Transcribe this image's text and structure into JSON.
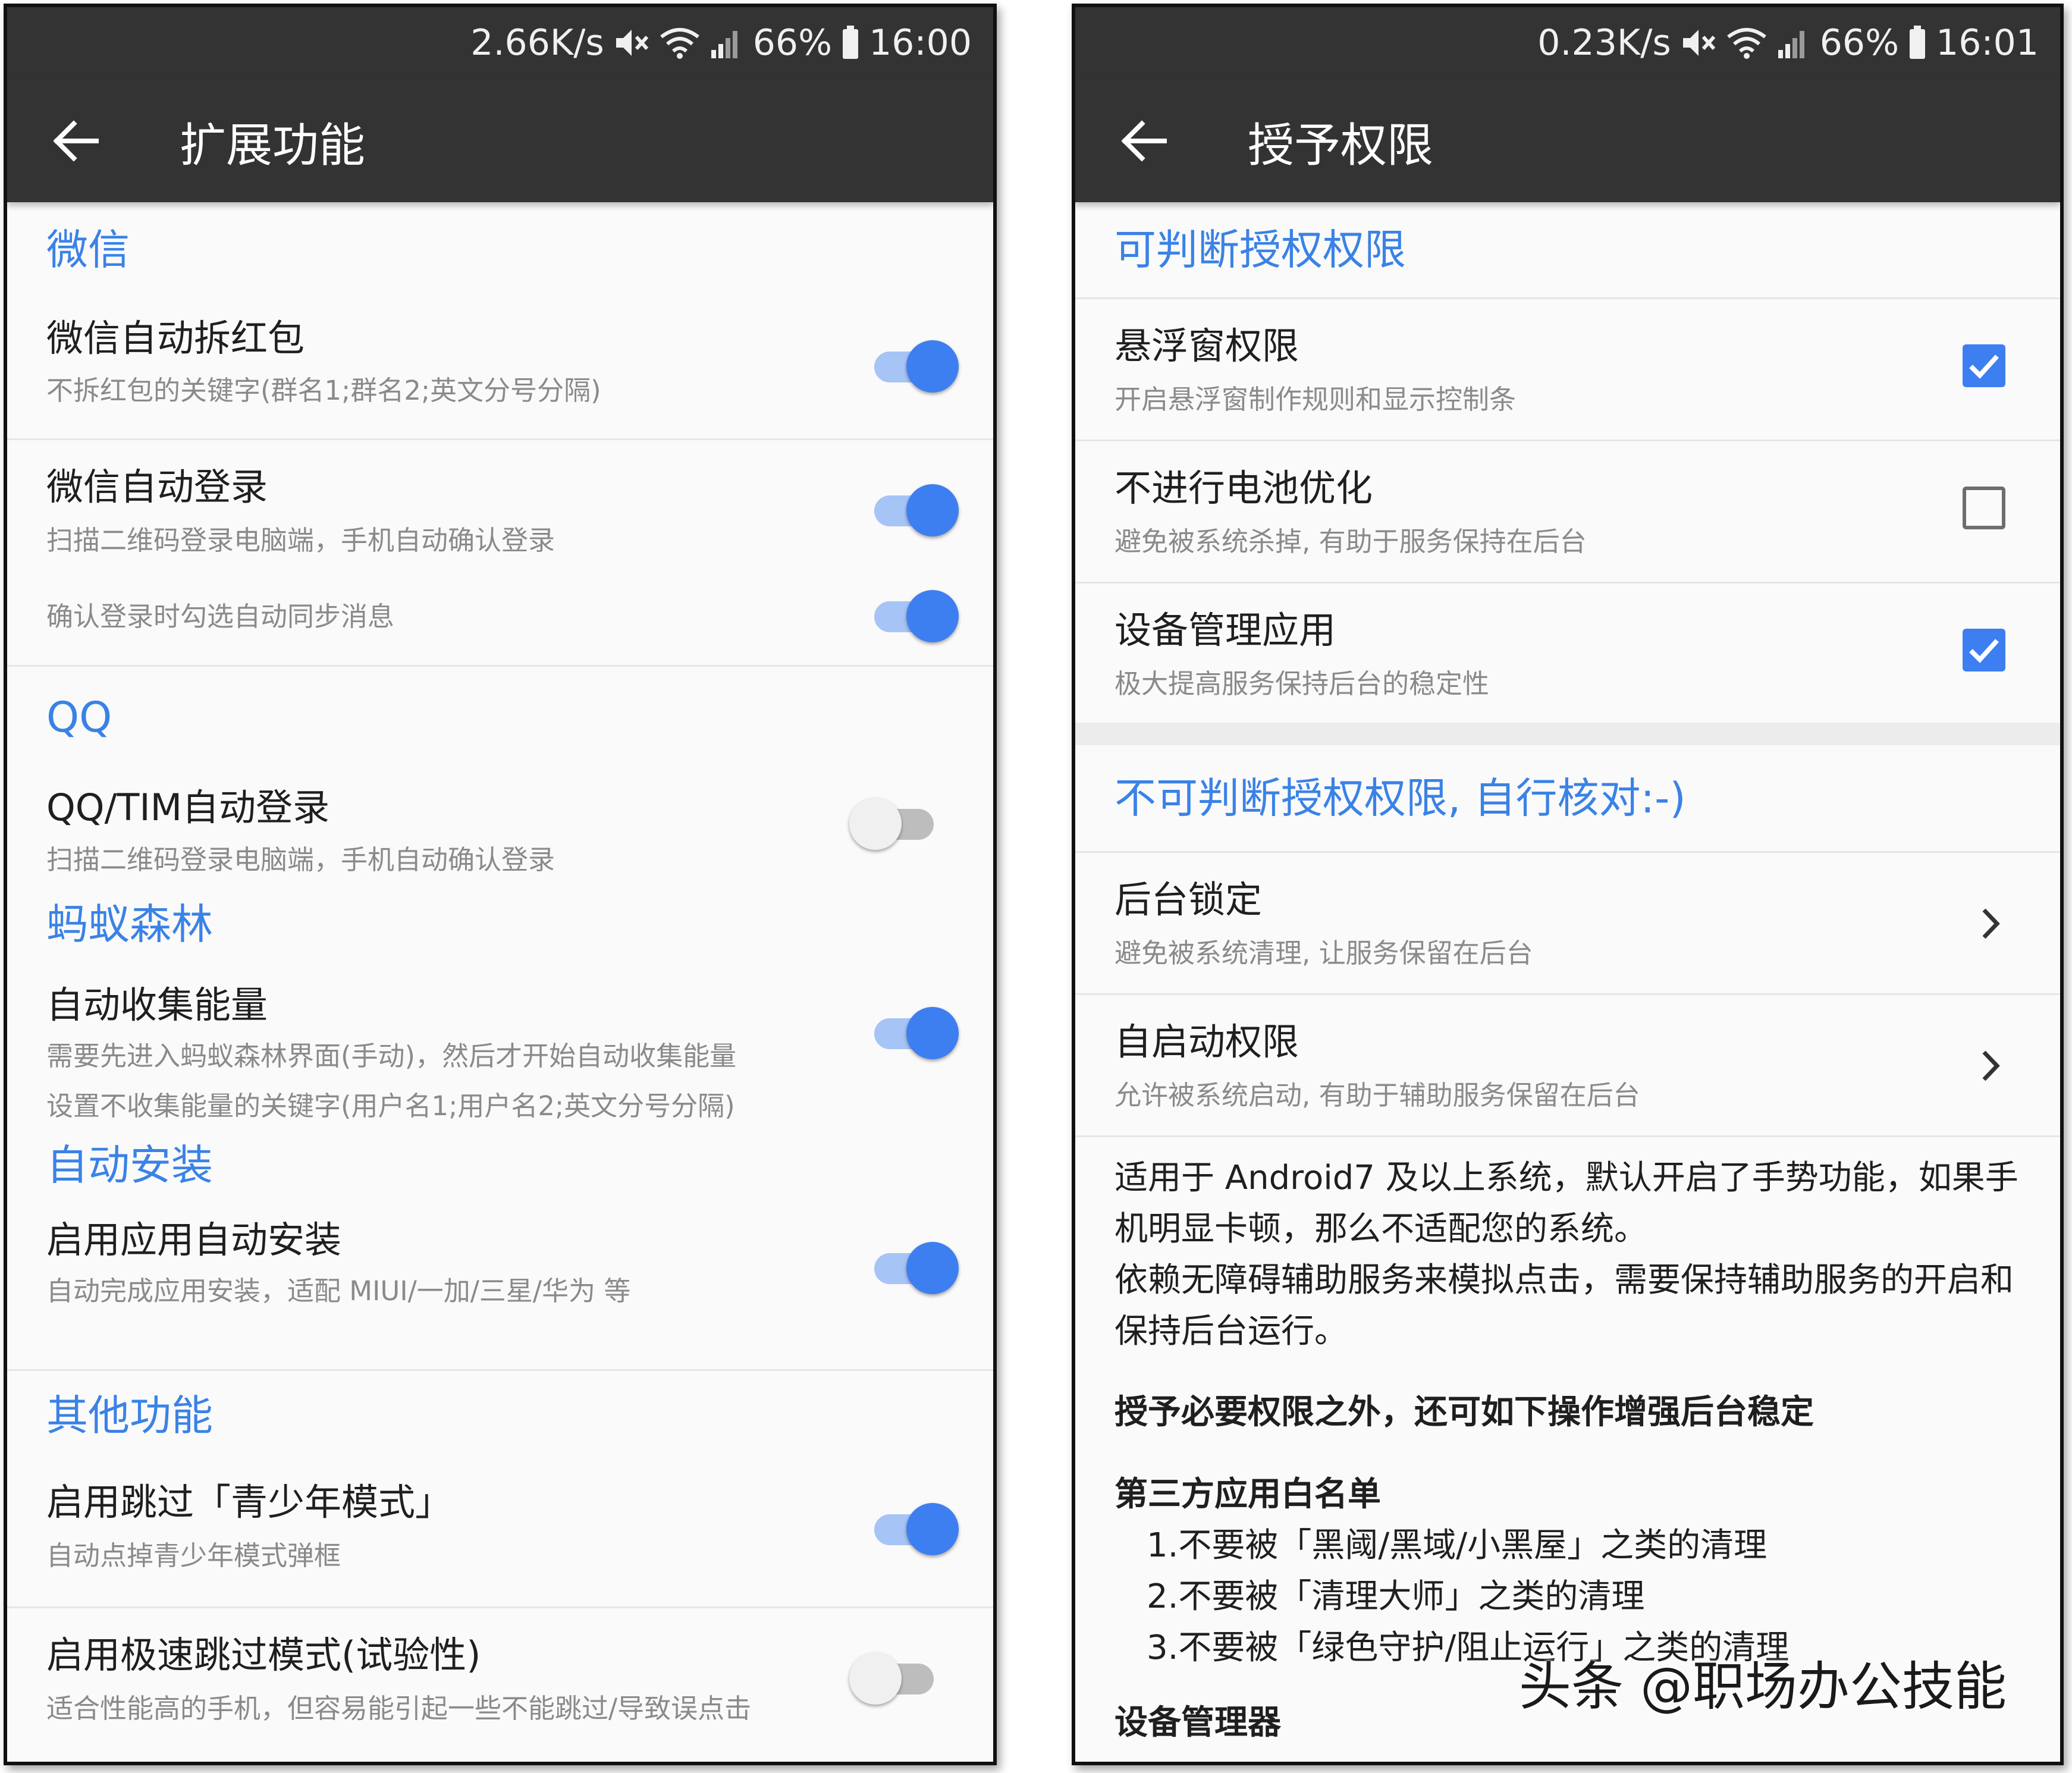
{
  "left": {
    "status": {
      "speed": "2.66K/s",
      "battery": "66%",
      "time": "16:00"
    },
    "title": "扩展功能",
    "sections": {
      "wechat": {
        "header": "微信",
        "red_packet": {
          "title": "微信自动拆红包",
          "sub": "不拆红包的关键字(群名1;群名2;英文分号分隔)",
          "on": true
        },
        "auto_login": {
          "title": "微信自动登录",
          "sub": "扫描二维码登录电脑端，手机自动确认登录",
          "on": true
        },
        "sync_msg": {
          "sub": "确认登录时勾选自动同步消息",
          "on": true
        }
      },
      "qq": {
        "header": "QQ",
        "tim_login": {
          "title": "QQ/TIM自动登录",
          "sub": "扫描二维码登录电脑端，手机自动确认登录",
          "on": false
        }
      },
      "antforest": {
        "header": "蚂蚁森林",
        "collect": {
          "title": "自动收集能量",
          "sub1": "需要先进入蚂蚁森林界面(手动)，然后才开始自动收集能量",
          "sub2": "设置不收集能量的关键字(用户名1;用户名2;英文分号分隔)",
          "on": true
        }
      },
      "install": {
        "header": "自动安装",
        "auto_install": {
          "title": "启用应用自动安装",
          "sub": "自动完成应用安装，适配 MIUI/一加/三星/华为 等",
          "on": true
        }
      },
      "other": {
        "header": "其他功能",
        "skip_teen": {
          "title": "启用跳过「青少年模式」",
          "sub": "自动点掉青少年模式弹框",
          "on": true
        },
        "fast_skip": {
          "title": "启用极速跳过模式(试验性)",
          "sub": "适合性能高的手机，但容易能引起一些不能跳过/导致误点击",
          "on": false
        }
      }
    }
  },
  "right": {
    "status": {
      "speed": "0.23K/s",
      "battery": "66%",
      "time": "16:01"
    },
    "title": "授予权限",
    "judgeable": {
      "header": "可判断授权权限",
      "float_window": {
        "title": "悬浮窗权限",
        "sub": "开启悬浮窗制作规则和显示控制条",
        "checked": true
      },
      "battery": {
        "title": "不进行电池优化",
        "sub": "避免被系统杀掉, 有助于服务保持在后台",
        "checked": false
      },
      "device_admin": {
        "title": "设备管理应用",
        "sub": "极大提高服务保持后台的稳定性",
        "checked": true
      }
    },
    "non_judgeable": {
      "header": "不可判断授权权限, 自行核对:-)",
      "bg_lock": {
        "title": "后台锁定",
        "sub": "避免被系统清理, 让服务保留在后台"
      },
      "autostart": {
        "title": "自启动权限",
        "sub": "允许被系统启动, 有助于辅助服务保留在后台"
      }
    },
    "notes": {
      "p1": "适用于 Android7 及以上系统，默认开启了手势功能，如果手机明显卡顿，那么不适配您的系统。",
      "p2": "依赖无障碍辅助服务来模拟点击，需要保持辅助服务的开启和保持后台运行。",
      "bold": "授予必要权限之外，还可如下操作增强后台稳定",
      "whitelist_title": "第三方应用白名单",
      "whitelist": [
        "1.不要被「黑阈/黑域/小黑屋」之类的清理",
        "2.不要被「清理大师」之类的清理",
        "3.不要被「绿色守护/阻止运行」之类的清理"
      ],
      "device_mgr": "设备管理器"
    },
    "watermark": "头条 @职场办公技能"
  }
}
